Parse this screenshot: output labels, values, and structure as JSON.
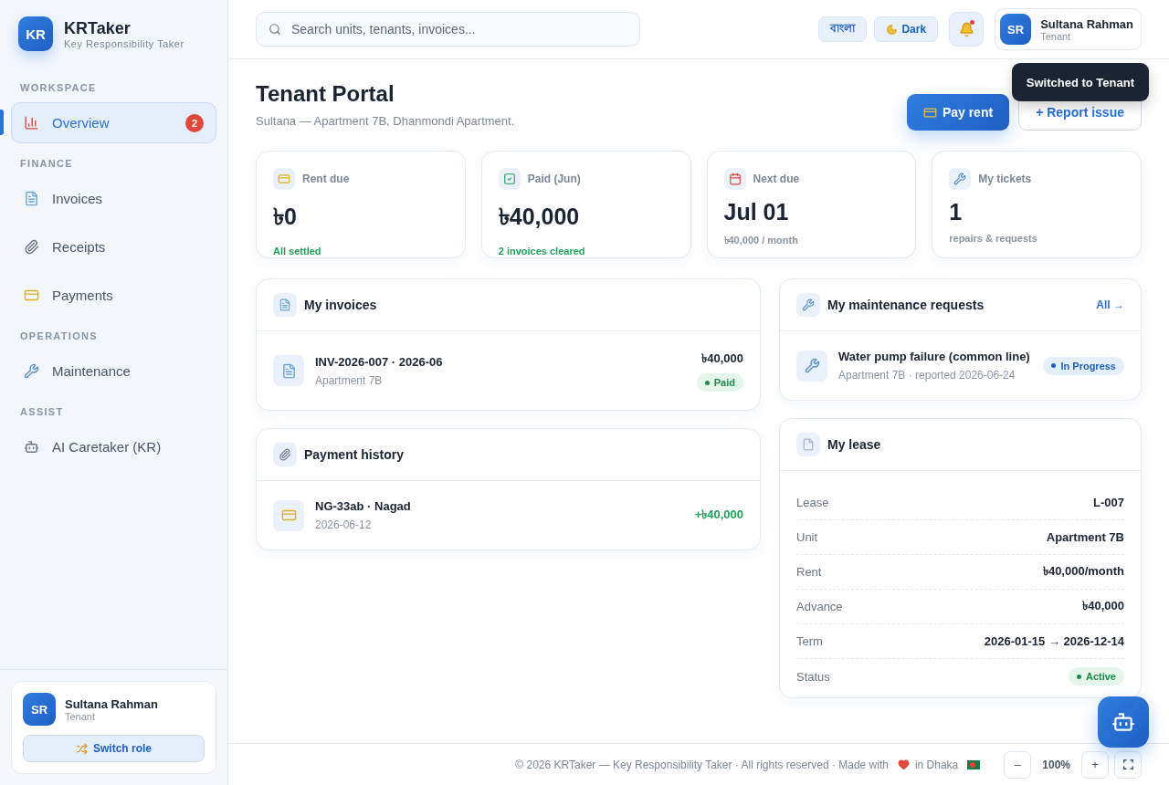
{
  "sidebar": {
    "brand": {
      "logo": "KR",
      "name": "KRTaker",
      "tagline": "Key Responsibility Taker"
    },
    "sections": [
      {
        "title": "WORKSPACE",
        "items": [
          {
            "label": "Overview",
            "selected": true,
            "badge": "2"
          }
        ]
      },
      {
        "title": "FINANCE",
        "items": [
          {
            "label": "Invoices",
            "selected": false
          },
          {
            "label": "Receipts",
            "selected": false
          },
          {
            "label": "Payments",
            "selected": false
          }
        ]
      },
      {
        "title": "OPERATIONS",
        "items": [
          {
            "label": "Maintenance",
            "selected": false
          }
        ]
      },
      {
        "title": "ASSIST",
        "items": [
          {
            "label": "AI Caretaker (KR)",
            "selected": false
          }
        ]
      }
    ],
    "user": {
      "initials": "SR",
      "name": "Sultana Rahman",
      "role": "Tenant"
    },
    "switch_button": "Switch role"
  },
  "header": {
    "search": {
      "placeholder": "Search units, tenants, invoices..."
    },
    "language_button": "বাংলা",
    "theme_button": "Dark",
    "notifications": {
      "unread": true
    },
    "user": {
      "initials": "SR",
      "name": "Sultana Rahman",
      "role": "Tenant"
    }
  },
  "page": {
    "title": "Tenant Portal",
    "subtitle": "Sultana — Apartment 7B, Dhanmondi Apartment.",
    "actions": [
      {
        "label": "Pay rent",
        "kind": "primary"
      },
      {
        "label": "+ Report issue",
        "kind": "secondary"
      }
    ],
    "toast": "Switched to Tenant"
  },
  "stats": [
    {
      "label": "Rent due",
      "value": "৳0",
      "note": "All settled",
      "kind": "positive"
    },
    {
      "label": "Paid (Jun)",
      "value": "৳40,000",
      "note": "2 invoices cleared",
      "kind": "positive"
    },
    {
      "label": "Next due",
      "value": "Jul 01",
      "note": "৳40,000 / month",
      "kind": "neutral"
    },
    {
      "label": "My tickets",
      "value": "1",
      "note": "repairs & requests",
      "kind": "neutral"
    }
  ],
  "invoices": {
    "title": "My invoices",
    "rows": [
      {
        "number": "INV-2026-007 · 2026-06",
        "unit": "Apartment 7B",
        "amount": "৳40,000",
        "status": {
          "label": "Paid",
          "kind": "success"
        }
      }
    ]
  },
  "payments": {
    "title": "Payment history",
    "rows": [
      {
        "reference": "NG-33ab · Nagad",
        "date": "2026-06-12",
        "amount": "+৳40,000"
      }
    ]
  },
  "maintenance": {
    "title": "My maintenance requests",
    "link": "All →",
    "rows": [
      {
        "title": "Water pump failure (common line)",
        "meta": "Apartment 7B · reported 2026-06-24",
        "status": {
          "label": "In Progress",
          "kind": "info"
        }
      }
    ]
  },
  "lease": {
    "title": "My lease",
    "fields": [
      {
        "label": "Lease",
        "value": "L-007",
        "kind": "text"
      },
      {
        "label": "Unit",
        "value": "Apartment 7B",
        "kind": "text"
      },
      {
        "label": "Rent",
        "value": "৳40,000/month",
        "kind": "text"
      },
      {
        "label": "Advance",
        "value": "৳40,000",
        "kind": "text"
      },
      {
        "label": "Term",
        "value": "2026-01-15 → 2026-12-14",
        "kind": "text"
      },
      {
        "label": "Status",
        "kind": "badge",
        "status": {
          "label": "Active",
          "kind": "success"
        }
      }
    ]
  },
  "footer": {
    "text": "© 2026 KRTaker — Key Responsibility Taker · All rights reserved · Made with",
    "location": "in Dhaka",
    "zoom_out": "–",
    "zoom_level": "100%",
    "zoom_in": "+"
  }
}
